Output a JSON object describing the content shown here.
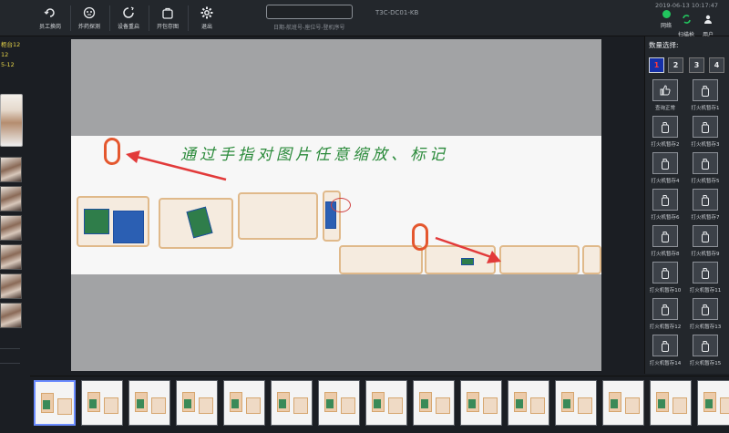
{
  "toolbar": {
    "buttons": [
      {
        "label": "员工换岗",
        "icon": "handover-icon"
      },
      {
        "label": "炸药探测",
        "icon": "explosive-detect-icon"
      },
      {
        "label": "设备重启",
        "icon": "restart-icon"
      },
      {
        "label": "开包存图",
        "icon": "open-bag-icon"
      },
      {
        "label": "退出",
        "icon": "gear-icon"
      }
    ],
    "scan_hint": "日期-航班号-座位号-登机序号",
    "device_id": "T3C-DC01-KB",
    "datetime": "2019-06-13 10:17:47",
    "status": [
      {
        "label": "网络",
        "icon": "network-dot-icon",
        "color": "#22c55e"
      },
      {
        "label": "扫描枪",
        "icon": "scanner-icon",
        "color": "#22c55e"
      },
      {
        "label": "用户",
        "icon": "user-icon"
      }
    ]
  },
  "left_panel": {
    "info_lines": [
      "柜台12",
      "12",
      "5-12"
    ]
  },
  "viewer": {
    "annotation": "通过手指对图片任意缩放、标记"
  },
  "right_panel": {
    "title": "数量选择:",
    "quantity_options": [
      "1",
      "2",
      "3",
      "4"
    ],
    "selected_quantity": "1",
    "tiles": [
      {
        "label": "查询正常",
        "icon": "thumbs-up-icon"
      },
      {
        "label": "打火机暂存1",
        "icon": "lighter-icon"
      },
      {
        "label": "打火机暂存2",
        "icon": "lighter-icon"
      },
      {
        "label": "打火机暂存3",
        "icon": "lighter-icon"
      },
      {
        "label": "打火机暂存4",
        "icon": "lighter-icon"
      },
      {
        "label": "打火机暂存5",
        "icon": "lighter-icon"
      },
      {
        "label": "打火机暂存6",
        "icon": "lighter-icon"
      },
      {
        "label": "打火机暂存7",
        "icon": "lighter-icon"
      },
      {
        "label": "打火机暂存8",
        "icon": "lighter-icon"
      },
      {
        "label": "打火机暂存9",
        "icon": "lighter-icon"
      },
      {
        "label": "打火机暂存10",
        "icon": "lighter-icon"
      },
      {
        "label": "打火机暂存11",
        "icon": "lighter-icon"
      },
      {
        "label": "打火机暂存12",
        "icon": "lighter-icon"
      },
      {
        "label": "打火机暂存13",
        "icon": "lighter-icon"
      },
      {
        "label": "打火机暂存14",
        "icon": "lighter-icon"
      },
      {
        "label": "打火机暂存15",
        "icon": "lighter-icon"
      }
    ]
  },
  "filmstrip": {
    "selected_index": 0,
    "frame_count": 15
  }
}
